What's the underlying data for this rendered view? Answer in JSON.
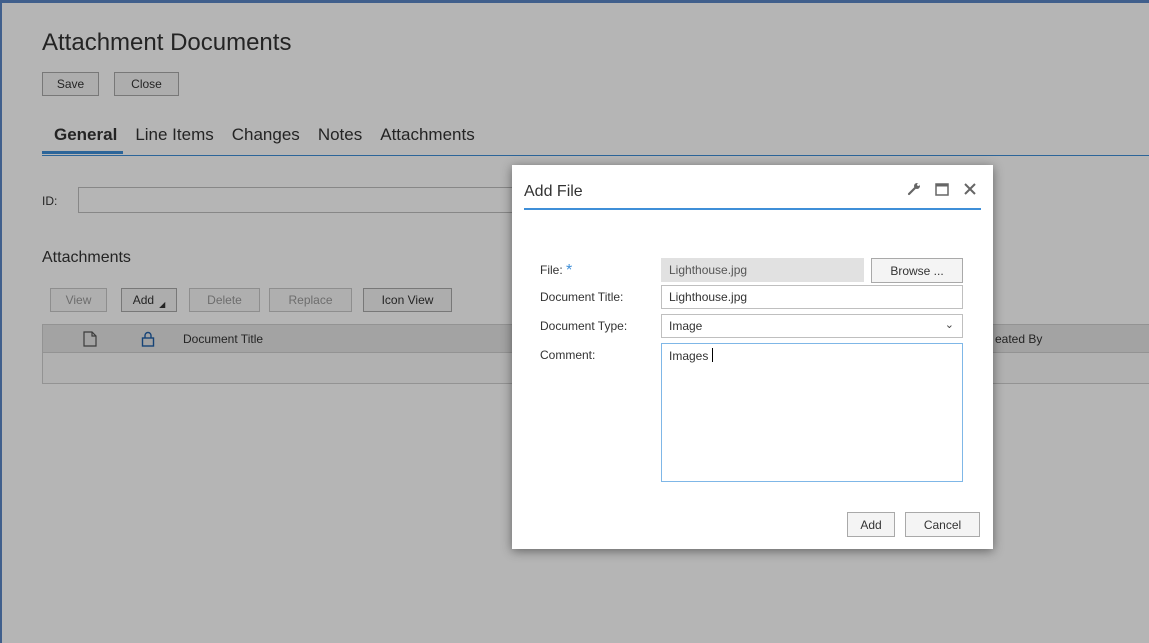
{
  "page": {
    "title": "Attachment Documents",
    "toolbar": {
      "save": "Save",
      "close": "Close"
    },
    "tabs": [
      "General",
      "Line Items",
      "Changes",
      "Notes",
      "Attachments"
    ],
    "id_label": "ID:",
    "attachments": {
      "title": "Attachments",
      "buttons": {
        "view": "View",
        "add": "Add",
        "delete": "Delete",
        "replace": "Replace",
        "icon_view": "Icon View"
      },
      "columns": {
        "document_title": "Document Title",
        "created_by": "eated By"
      }
    }
  },
  "dialog": {
    "title": "Add File",
    "fields": {
      "file_label": "File:",
      "required_marker": "*",
      "file_value": "Lighthouse.jpg",
      "browse": "Browse ...",
      "doc_title_label": "Document Title:",
      "doc_title_value": "Lighthouse.jpg",
      "doc_type_label": "Document Type:",
      "doc_type_value": "Image",
      "comment_label": "Comment:",
      "comment_value": "Images "
    },
    "buttons": {
      "add": "Add",
      "cancel": "Cancel"
    }
  },
  "colors": {
    "accent": "#3f8fd8",
    "frame": "#5b86c5"
  }
}
